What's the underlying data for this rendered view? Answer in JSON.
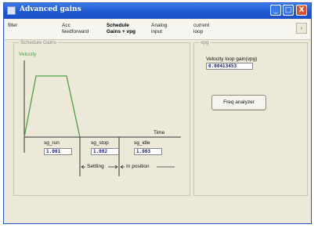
{
  "window": {
    "title": "Advanced gains",
    "controls": [
      "_",
      "□",
      "X"
    ]
  },
  "tabs": [
    {
      "line1": "filter",
      "line2": ""
    },
    {
      "line1": "Acc",
      "line2": "feedforward"
    },
    {
      "line1": "Schedule",
      "line2": "Gains + vpg",
      "active": true
    },
    {
      "line1": "Analog",
      "line2": "input"
    },
    {
      "line1": "current",
      "line2": "loop"
    }
  ],
  "tab_scroll_icon": "chevron-right-icon",
  "schedule_gains": {
    "title": "Schedule Gains",
    "y_label": "Velocity",
    "x_label": "Time",
    "fields": [
      {
        "label": "sg_run",
        "value": "1.001"
      },
      {
        "label": "sg_stop",
        "value": "1.002"
      },
      {
        "label": "sg_idle",
        "value": "1.003"
      }
    ],
    "settling_label": "Settling",
    "in_position_label": "In position"
  },
  "vpg": {
    "title": "vpg",
    "gain_label": "Velocity loop gain(vpg)",
    "gain_value": "0.00413453",
    "freq_button": "Freq analyzer"
  },
  "colors": {
    "title_bar": "#1f58d4",
    "velocity_line": "#4f9e49",
    "value_text": "#1a1a7a",
    "close_button": "#d9532c"
  }
}
